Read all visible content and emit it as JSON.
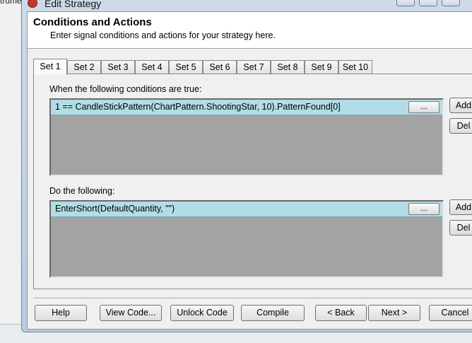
{
  "background": {
    "left_text": "trume"
  },
  "window": {
    "title": "Edit Strategy"
  },
  "header": {
    "title": "Conditions and Actions",
    "subtitle": "Enter signal conditions and actions for your strategy here."
  },
  "tabs": [
    {
      "label": "Set 1",
      "active": true
    },
    {
      "label": "Set 2",
      "active": false
    },
    {
      "label": "Set 3",
      "active": false
    },
    {
      "label": "Set 4",
      "active": false
    },
    {
      "label": "Set 5",
      "active": false
    },
    {
      "label": "Set 6",
      "active": false
    },
    {
      "label": "Set 7",
      "active": false
    },
    {
      "label": "Set 8",
      "active": false
    },
    {
      "label": "Set 9",
      "active": false
    },
    {
      "label": "Set 10",
      "active": false
    }
  ],
  "conditions": {
    "label": "When the following conditions are true:",
    "items": [
      "1 == CandleStickPattern(ChartPattern.ShootingStar, 10).PatternFound[0]"
    ],
    "ellipsis_label": "...",
    "add_label": "Add",
    "del_label": "Del"
  },
  "actions": {
    "label": "Do the following:",
    "items": [
      "EnterShort(DefaultQuantity, \"\")"
    ],
    "ellipsis_label": "...",
    "add_label": "Add",
    "del_label": "Del"
  },
  "footer": {
    "help": "Help",
    "view_code": "View Code...",
    "unlock_code": "Unlock Code",
    "compile": "Compile",
    "back": "< Back",
    "next": "Next >",
    "cancel": "Cancel"
  },
  "colors": {
    "selected_row": "#b2dde6",
    "list_background": "#a3a3a3",
    "title_icon": "#c0392b"
  }
}
